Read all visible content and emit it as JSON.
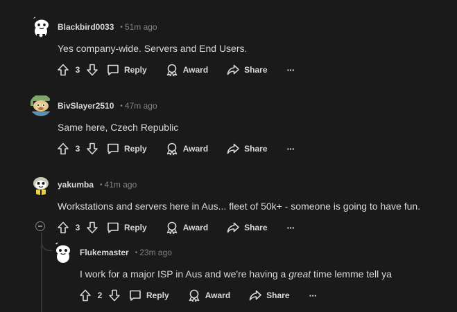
{
  "comments": [
    {
      "author": "Blackbird0033",
      "time": "51m ago",
      "body": "Yes company-wide. Servers and End Users.",
      "votes": "3",
      "reply_label": "Reply",
      "award_label": "Award",
      "share_label": "Share",
      "more_label": "···"
    },
    {
      "author": "BivSlayer2510",
      "time": "47m ago",
      "body": "Same here, Czech Republic",
      "votes": "3",
      "reply_label": "Reply",
      "award_label": "Award",
      "share_label": "Share",
      "more_label": "···"
    },
    {
      "author": "yakumba",
      "time": "41m ago",
      "body": "Workstations and servers here in Aus... fleet of 50k+ - someone is going to have fun.",
      "votes": "3",
      "reply_label": "Reply",
      "award_label": "Award",
      "share_label": "Share",
      "more_label": "···"
    },
    {
      "author": "Flukemaster",
      "time": "23m ago",
      "body_before": "I work for a major ISP in Aus and we're having a ",
      "body_emphasis": "great",
      "body_after": " time lemme tell ya",
      "votes": "2",
      "reply_label": "Reply",
      "award_label": "Award",
      "share_label": "Share",
      "more_label": "···"
    }
  ],
  "separator": "•",
  "colors": {
    "background": "#1a1a1b",
    "text": "#d7dadc",
    "muted": "#818384",
    "thread_line": "#343536"
  },
  "icons": [
    "snoo-avatar-icon",
    "upvote-icon",
    "downvote-icon",
    "comment-icon",
    "award-icon",
    "share-icon",
    "collapse-icon"
  ]
}
